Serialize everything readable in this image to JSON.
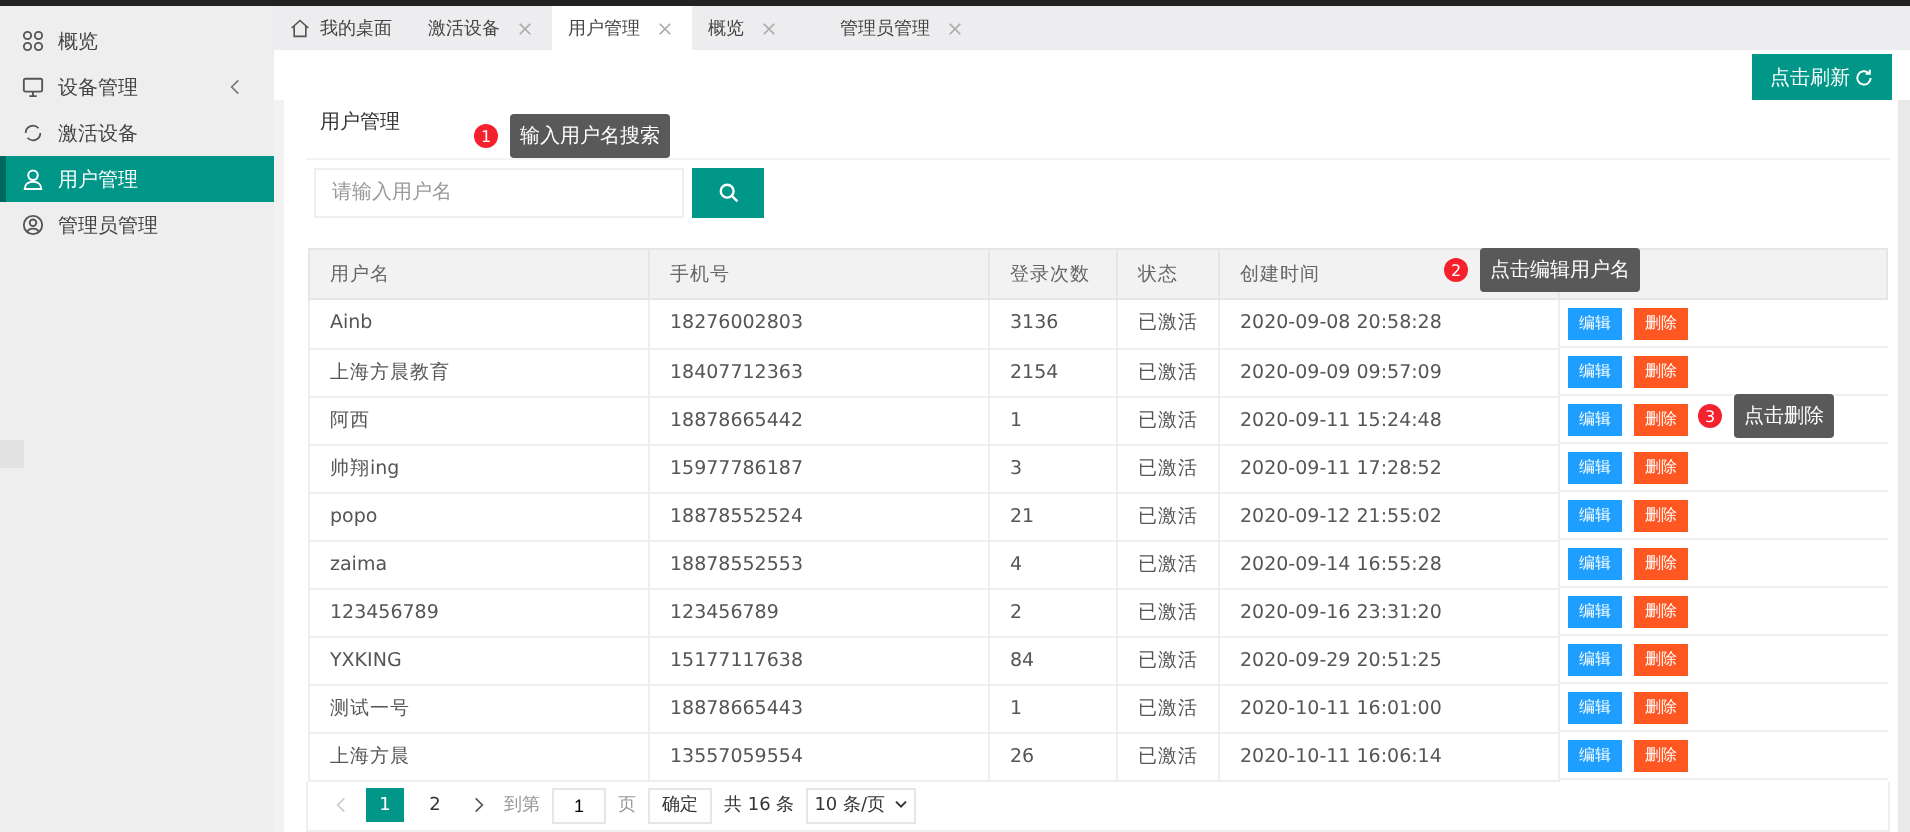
{
  "sidebar": {
    "items": [
      {
        "label": "概览",
        "kind": "link",
        "selected": false
      },
      {
        "label": "设备管理",
        "kind": "submenu",
        "selected": false
      },
      {
        "label": "激活设备",
        "kind": "link",
        "selected": false
      },
      {
        "label": "用户管理",
        "kind": "link",
        "selected": true
      },
      {
        "label": "管理员管理",
        "kind": "link",
        "selected": false
      }
    ]
  },
  "tabs": [
    {
      "label": "我的桌面",
      "kind": "home",
      "selected": false
    },
    {
      "label": "激活设备",
      "kind": "page",
      "selected": false
    },
    {
      "label": "用户管理",
      "kind": "page",
      "selected": true
    },
    {
      "label": "概览",
      "kind": "page",
      "selected": false
    },
    {
      "label": "管理员管理",
      "kind": "page",
      "selected": false
    }
  ],
  "refresh_button": "点击刷新",
  "page_title": "用户管理",
  "search": {
    "placeholder": "请输入用户名"
  },
  "table": {
    "columns": [
      "用户名",
      "手机号",
      "登录次数",
      "状态",
      "创建时间"
    ],
    "rows": [
      {
        "cells": [
          "Ainb",
          "18276002803",
          "3136",
          "已激活",
          "2020-09-08 20:58:28"
        ],
        "edit": "编辑",
        "delete": "删除"
      },
      {
        "cells": [
          "上海方晨教育",
          "18407712363",
          "2154",
          "已激活",
          "2020-09-09 09:57:09"
        ],
        "edit": "编辑",
        "delete": "删除"
      },
      {
        "cells": [
          "阿西",
          "18878665442",
          "1",
          "已激活",
          "2020-09-11 15:24:48"
        ],
        "edit": "编辑",
        "delete": "删除"
      },
      {
        "cells": [
          "帅翔ing",
          "15977786187",
          "3",
          "已激活",
          "2020-09-11 17:28:52"
        ],
        "edit": "编辑",
        "delete": "删除"
      },
      {
        "cells": [
          "popo",
          "18878552524",
          "21",
          "已激活",
          "2020-09-12 21:55:02"
        ],
        "edit": "编辑",
        "delete": "删除"
      },
      {
        "cells": [
          "zaima",
          "18878552553",
          "4",
          "已激活",
          "2020-09-14 16:55:28"
        ],
        "edit": "编辑",
        "delete": "删除"
      },
      {
        "cells": [
          "123456789",
          "123456789",
          "2",
          "已激活",
          "2020-09-16 23:31:20"
        ],
        "edit": "编辑",
        "delete": "删除"
      },
      {
        "cells": [
          "YXKING",
          "15177117638",
          "84",
          "已激活",
          "2020-09-29 20:51:25"
        ],
        "edit": "编辑",
        "delete": "删除"
      },
      {
        "cells": [
          "测试一号",
          "18878665443",
          "1",
          "已激活",
          "2020-10-11 16:01:00"
        ],
        "edit": "编辑",
        "delete": "删除"
      },
      {
        "cells": [
          "上海方晨",
          "13557059554",
          "26",
          "已激活",
          "2020-10-11 16:06:14"
        ],
        "edit": "编辑",
        "delete": "删除"
      }
    ]
  },
  "pagination": {
    "pages": [
      {
        "label": "1",
        "selected": true
      },
      {
        "label": "2",
        "selected": false
      }
    ],
    "goto_label": "到第",
    "goto_value": "1",
    "page_unit": "页",
    "confirm": "确定",
    "total": "共 16 条",
    "page_size": "10 条/页"
  },
  "callouts": [
    {
      "number": "1",
      "text": "输入用户名搜索"
    },
    {
      "number": "2",
      "text": "点击编辑用户名"
    },
    {
      "number": "3",
      "text": "点击删除"
    }
  ]
}
